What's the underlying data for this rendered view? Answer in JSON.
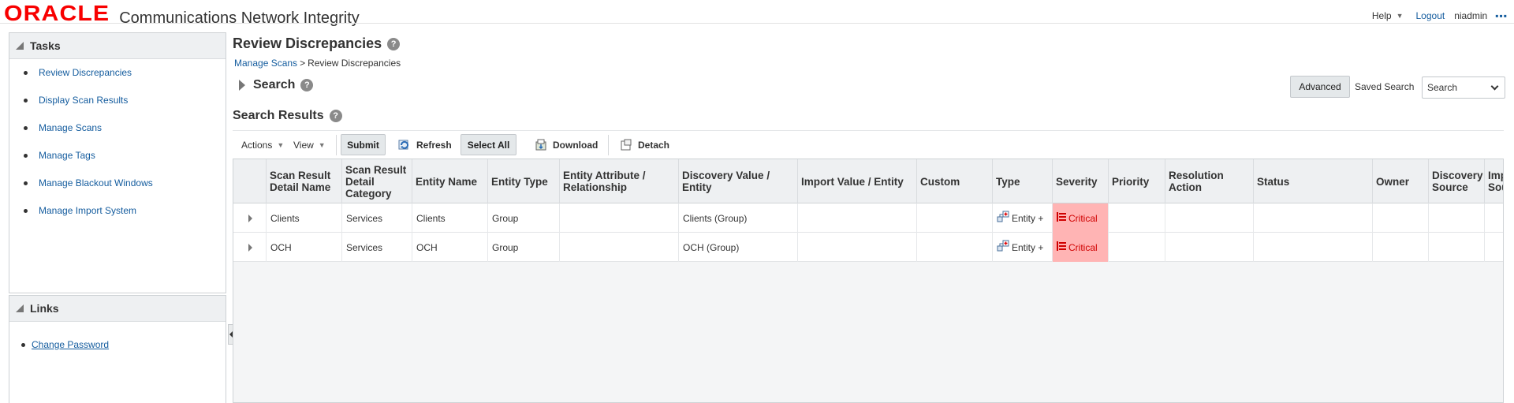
{
  "header": {
    "logo": "ORACLE",
    "app_title": "Communications Network Integrity",
    "help": "Help",
    "logout": "Logout",
    "user": "niadmin"
  },
  "tasks": {
    "title": "Tasks",
    "items": [
      {
        "label": "Review Discrepancies"
      },
      {
        "label": "Display Scan Results"
      },
      {
        "label": "Manage Scans"
      },
      {
        "label": "Manage Tags"
      },
      {
        "label": "Manage Blackout Windows"
      },
      {
        "label": "Manage Import System"
      }
    ]
  },
  "links": {
    "title": "Links",
    "items": [
      {
        "label": "Change Password"
      }
    ]
  },
  "page": {
    "title": "Review Discrepancies",
    "breadcrumb_parent": "Manage Scans",
    "breadcrumb_sep": ">",
    "breadcrumb_current": "Review Discrepancies"
  },
  "search": {
    "title": "Search",
    "advanced_label": "Advanced",
    "saved_search_label": "Saved Search",
    "saved_search_value": "Search"
  },
  "results": {
    "title": "Search Results",
    "toolbar": {
      "actions": "Actions",
      "view": "View",
      "submit": "Submit",
      "refresh": "Refresh",
      "select_all": "Select All",
      "download": "Download",
      "detach": "Detach"
    },
    "columns": [
      {
        "label": "Scan Result Detail Name"
      },
      {
        "label": "Scan Result Detail Category"
      },
      {
        "label": "Entity Name"
      },
      {
        "label": "Entity Type"
      },
      {
        "label": "Entity Attribute / Relationship"
      },
      {
        "label": "Discovery Value / Entity"
      },
      {
        "label": "Import Value / Entity"
      },
      {
        "label": "Custom"
      },
      {
        "label": "Type"
      },
      {
        "label": "Severity"
      },
      {
        "label": "Priority"
      },
      {
        "label": "Resolution Action"
      },
      {
        "label": "Status"
      },
      {
        "label": "Owner"
      },
      {
        "label": "Discovery Source"
      },
      {
        "label": "Import Source"
      }
    ],
    "rows": [
      {
        "name": "Clients",
        "category": "Services",
        "entity_name": "Clients",
        "entity_type": "Group",
        "attribute": "",
        "discovery_value": "Clients (Group)",
        "import_value": "",
        "custom": "",
        "type": "Entity +",
        "severity": "Critical",
        "priority": "",
        "resolution": "",
        "status": "",
        "owner": "",
        "discovery_source": "",
        "import_source": ""
      },
      {
        "name": "OCH",
        "category": "Services",
        "entity_name": "OCH",
        "entity_type": "Group",
        "attribute": "",
        "discovery_value": "OCH (Group)",
        "import_value": "",
        "custom": "",
        "type": "Entity +",
        "severity": "Critical",
        "priority": "",
        "resolution": "",
        "status": "",
        "owner": "",
        "discovery_source": "",
        "import_source": ""
      }
    ]
  },
  "colors": {
    "brand_red": "#f80000",
    "link_blue": "#145c9e",
    "critical_bg": "#ffb4b4",
    "critical_text": "#d00000"
  }
}
